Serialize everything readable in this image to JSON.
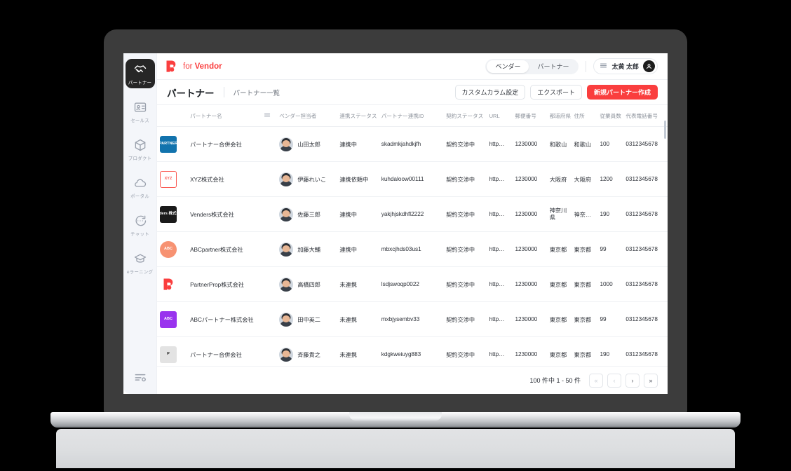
{
  "brand": {
    "name": "for Vendor",
    "bold_part": "Vendor",
    "accent": "#fa3e3e"
  },
  "sidebar": {
    "items": [
      {
        "label": "パートナー",
        "icon": "handshake-icon",
        "active": true
      },
      {
        "label": "セールス",
        "icon": "contact-card-icon",
        "active": false
      },
      {
        "label": "プロダクト",
        "icon": "cube-icon",
        "active": false
      },
      {
        "label": "ポータル",
        "icon": "cloud-icon",
        "active": false
      },
      {
        "label": "チャット",
        "icon": "chat-bubble-icon",
        "active": false
      },
      {
        "label": "eラーニング",
        "icon": "graduation-cap-icon",
        "active": false
      }
    ],
    "bottom_icon": "settings-list-icon"
  },
  "topbar": {
    "segments": [
      {
        "label": "ベンダー",
        "selected": true
      },
      {
        "label": "パートナー",
        "selected": false
      }
    ],
    "user_name": "太黄 太郎",
    "menu_icon": "hamburger-icon",
    "avatar_icon": "user-avatar-icon"
  },
  "pagehead": {
    "title": "パートナー",
    "breadcrumb": "パートナー一覧",
    "buttons": [
      {
        "label": "カスタムカラム設定",
        "style": "ghost"
      },
      {
        "label": "エクスポート",
        "style": "ghost"
      },
      {
        "label": "新規パートナー作成",
        "style": "primary"
      }
    ]
  },
  "table": {
    "columns": [
      "パートナー名",
      "ベンダー担当者",
      "連携ステータス",
      "パートナー連携ID",
      "契約ステータス",
      "URL",
      "郵便番号",
      "都道府県",
      "住所",
      "従業員数",
      "代表電話番号"
    ],
    "column_menu_icon": "column-menu-icon",
    "rows": [
      {
        "logo": {
          "text": "PARTNER",
          "bg": "#1273ad",
          "fg": "#ffffff",
          "shape": "square"
        },
        "name": "パートナー合併会社",
        "owner": "山田太郎",
        "link_status": "連携中",
        "partner_id": "skadmkjahdkjfh",
        "contract_status": "契約交渉中",
        "url": "http…",
        "zip": "1230000",
        "pref": "和歌山",
        "address": "和歌山",
        "employees": "100",
        "tel": "0312345678"
      },
      {
        "logo": {
          "text": "XYZ",
          "bg": "#ffffff",
          "fg": "#fa5a53",
          "shape": "square-outline"
        },
        "name": "XYZ株式会社",
        "owner": "伊藤れいこ",
        "link_status": "連携依頼中",
        "partner_id": "kuhdaloow00111",
        "contract_status": "契約交渉中",
        "url": "http…",
        "zip": "1230000",
        "pref": "大阪府",
        "address": "大阪府",
        "employees": "1200",
        "tel": "0312345678"
      },
      {
        "logo": {
          "text": "Venders 株式会社",
          "bg": "#1a1a1a",
          "fg": "#ffffff",
          "shape": "square"
        },
        "name": "Venders株式会社",
        "owner": "佐藤三郎",
        "link_status": "連携中",
        "partner_id": "yakjhjskdhfl2222",
        "contract_status": "契約交渉中",
        "url": "http…",
        "zip": "1230000",
        "pref": "神奈川県",
        "address": "神奈…",
        "employees": "190",
        "tel": "0312345678"
      },
      {
        "logo": {
          "text": "ABC",
          "bg": "#f79272",
          "fg": "#ffffff",
          "shape": "circle"
        },
        "name": "ABCpartner株式会社",
        "owner": "加藤大輔",
        "link_status": "連携中",
        "partner_id": "mbxcjhds03us1",
        "contract_status": "契約交渉中",
        "url": "http…",
        "zip": "1230000",
        "pref": "東京都",
        "address": "東京都",
        "employees": "99",
        "tel": "0312345678"
      },
      {
        "logo": {
          "text": "",
          "bg": "#ffffff",
          "fg": "#fa3e3e",
          "shape": "mark"
        },
        "name": "PartnerProp株式会社",
        "owner": "高橋四郎",
        "link_status": "未連携",
        "partner_id": "lsdjswoqp0022",
        "contract_status": "契約交渉中",
        "url": "http…",
        "zip": "1230000",
        "pref": "東京都",
        "address": "東京都",
        "employees": "1000",
        "tel": "0312345678"
      },
      {
        "logo": {
          "text": "ABC",
          "bg": "#9933ee",
          "fg": "#ffffff",
          "shape": "square"
        },
        "name": "ABCパートナー株式会社",
        "owner": "田中英二",
        "link_status": "未連携",
        "partner_id": "mxbjysembv33",
        "contract_status": "契約交渉中",
        "url": "http…",
        "zip": "1230000",
        "pref": "東京都",
        "address": "東京都",
        "employees": "99",
        "tel": "0312345678"
      },
      {
        "logo": {
          "text": "P",
          "bg": "#e3e3e3",
          "fg": "#1a1a1a",
          "shape": "square"
        },
        "name": "パートナー合併会社",
        "owner": "斉藤貴之",
        "link_status": "未連携",
        "partner_id": "kdgkweiuyg883",
        "contract_status": "契約交渉中",
        "url": "http…",
        "zip": "1230000",
        "pref": "東京都",
        "address": "東京都",
        "employees": "190",
        "tel": "0312345678"
      }
    ]
  },
  "pagination": {
    "summary": "100 件中 1 - 50 件",
    "first_label": "«",
    "prev_label": "‹",
    "next_label": "›",
    "last_label": "»"
  }
}
